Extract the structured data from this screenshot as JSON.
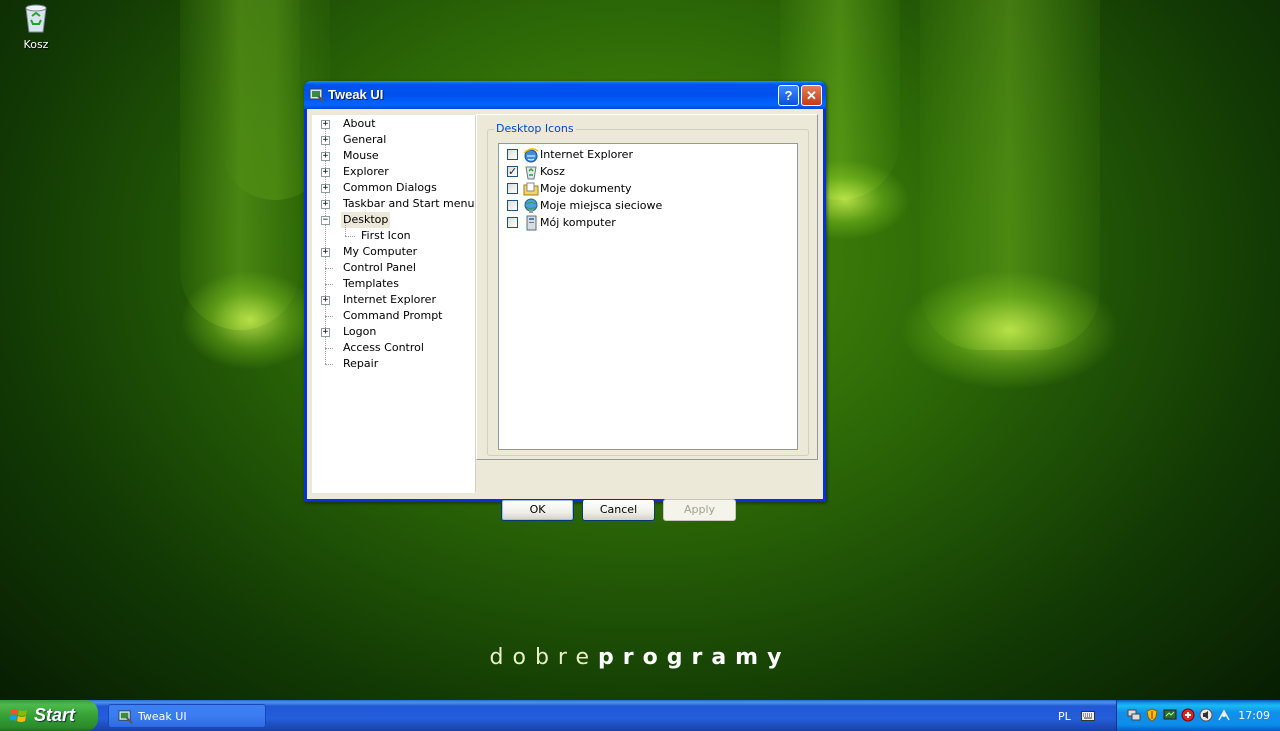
{
  "desktop": {
    "icon_label": "Kosz",
    "wallpaper_text_light": "dobre",
    "wallpaper_text_bold": "programy"
  },
  "window": {
    "title": "Tweak UI",
    "help_button": "?",
    "close_button": "✕"
  },
  "tree": {
    "items": [
      {
        "label": "About",
        "expander": "+"
      },
      {
        "label": "General",
        "expander": "+"
      },
      {
        "label": "Mouse",
        "expander": "+"
      },
      {
        "label": "Explorer",
        "expander": "+"
      },
      {
        "label": "Common Dialogs",
        "expander": "+"
      },
      {
        "label": "Taskbar and Start menu",
        "expander": "+"
      },
      {
        "label": "Desktop",
        "expander": "−"
      },
      {
        "label": "First Icon",
        "expander": ""
      },
      {
        "label": "My Computer",
        "expander": "+"
      },
      {
        "label": "Control Panel",
        "expander": ""
      },
      {
        "label": "Templates",
        "expander": ""
      },
      {
        "label": "Internet Explorer",
        "expander": "+"
      },
      {
        "label": "Command Prompt",
        "expander": ""
      },
      {
        "label": "Logon",
        "expander": "+"
      },
      {
        "label": "Access Control",
        "expander": ""
      },
      {
        "label": "Repair",
        "expander": ""
      }
    ],
    "selected": "Desktop"
  },
  "panel": {
    "group_title": "Desktop Icons",
    "items": [
      {
        "label": "Internet Explorer",
        "checked": false,
        "icon": "internet-explorer-icon"
      },
      {
        "label": "Kosz",
        "checked": true,
        "icon": "recycle-bin-icon"
      },
      {
        "label": "Moje dokumenty",
        "checked": false,
        "icon": "my-documents-icon"
      },
      {
        "label": "Moje miejsca sieciowe",
        "checked": false,
        "icon": "network-places-icon"
      },
      {
        "label": "Mój komputer",
        "checked": false,
        "icon": "my-computer-icon"
      }
    ]
  },
  "buttons": {
    "ok": "OK",
    "cancel": "Cancel",
    "apply": "Apply"
  },
  "taskbar": {
    "start_label": "Start",
    "task_label": "Tweak UI",
    "language": "PL",
    "clock": "17:09"
  },
  "colors": {
    "title_blue": "#0050ee",
    "start_green": "#36a236",
    "group_title": "#0046d5",
    "dialog_face": "#ece9d8"
  }
}
